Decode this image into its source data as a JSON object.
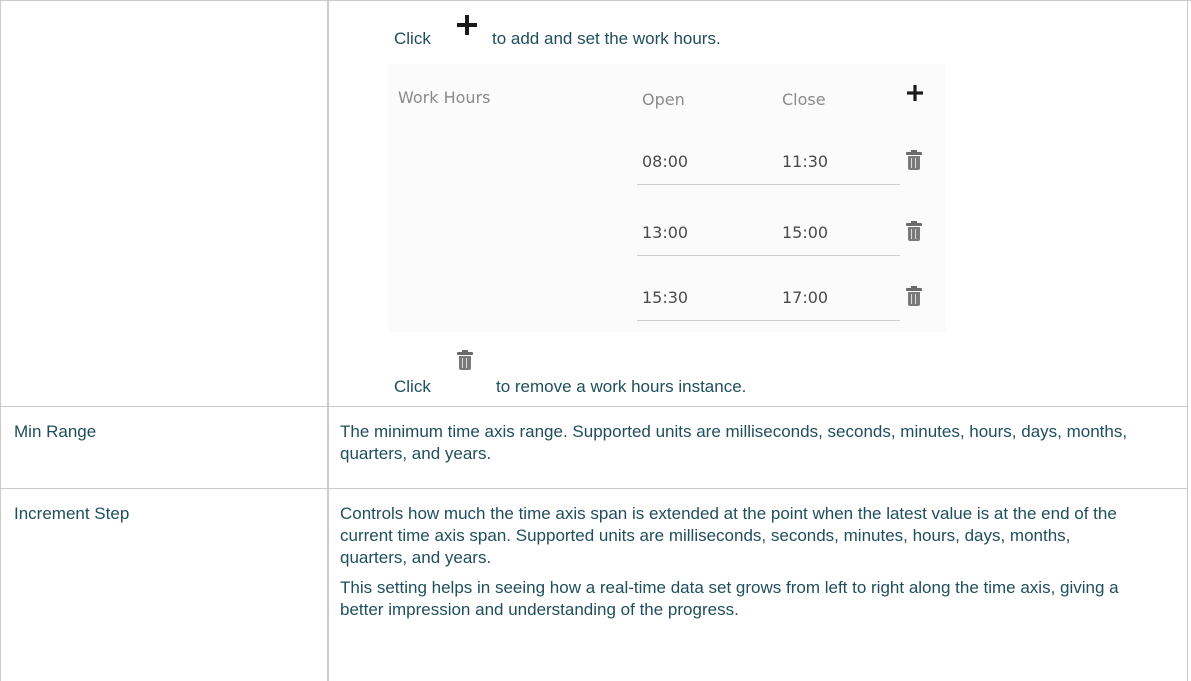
{
  "work_hours_row": {
    "click_prefix_1": "Click",
    "add_suffix": "to add and set the work hours.",
    "click_prefix_2": "Click",
    "remove_suffix": "to remove a work hours instance.",
    "panel": {
      "title": "Work Hours",
      "col_open": "Open",
      "col_close": "Close",
      "rows": [
        {
          "open": "08:00",
          "close": "11:30"
        },
        {
          "open": "13:00",
          "close": "15:00"
        },
        {
          "open": "15:30",
          "close": "17:00"
        }
      ]
    }
  },
  "rows": [
    {
      "name": "Min Range",
      "paragraphs": [
        "The minimum time axis range. Supported units are milliseconds, seconds, minutes, hours, days, months, quarters, and years."
      ]
    },
    {
      "name": "Increment Step",
      "paragraphs": [
        "Controls how much the time axis span is extended at the point when the latest value is at the end of the current time axis span. Supported units are milliseconds, seconds, minutes, hours, days, months, quarters, and years.",
        "This setting helps in seeing how a real-time data set grows from left to right along the time axis, giving a better impression and understanding of the progress."
      ]
    }
  ]
}
